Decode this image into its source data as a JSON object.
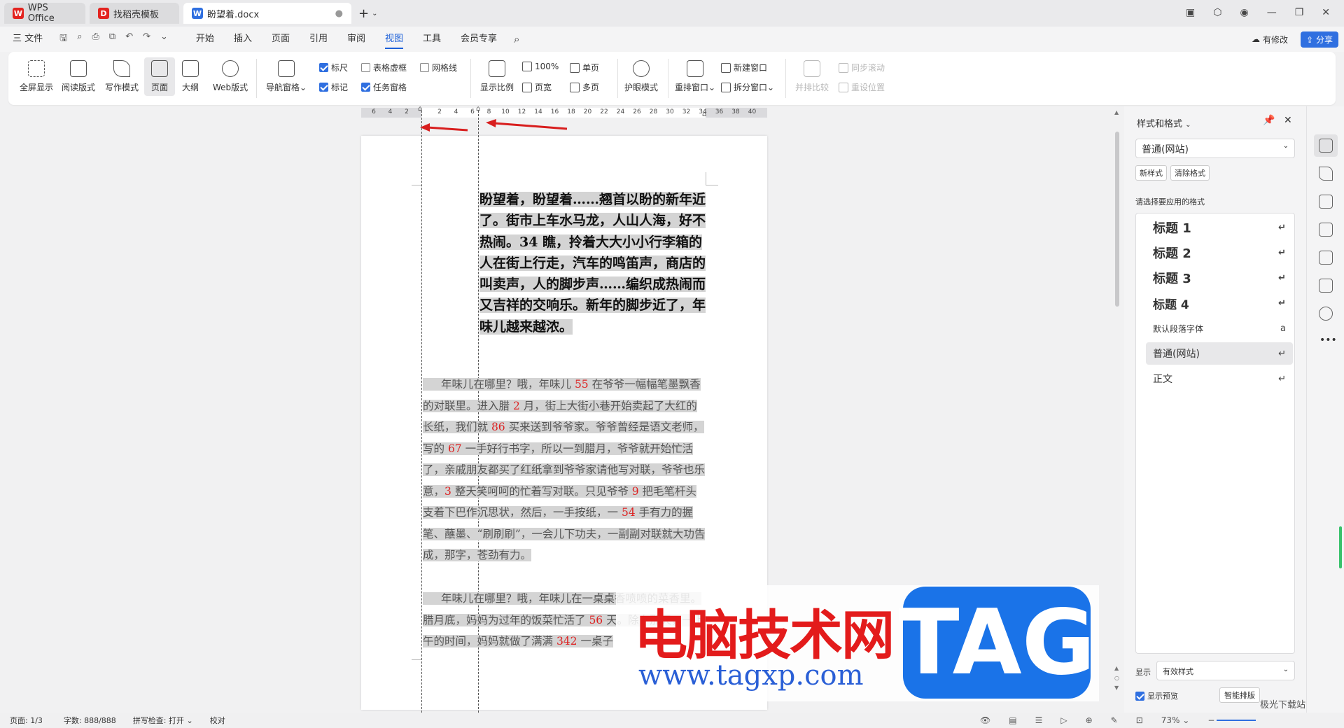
{
  "tabs": [
    {
      "label": "WPS Office",
      "logo": "W",
      "color": "#e3231f"
    },
    {
      "label": "找稻壳模板",
      "logo": "D",
      "color": "#e3231f"
    },
    {
      "label": "盼望着.docx",
      "logo": "W",
      "color": "#2f6fe0"
    }
  ],
  "menu": {
    "file": "三 文件",
    "items": [
      "开始",
      "插入",
      "页面",
      "引用",
      "审阅",
      "视图",
      "工具",
      "会员专享"
    ],
    "active": "视图",
    "modified": "有修改",
    "share": "分享"
  },
  "ribbon": {
    "fullscreen": "全屏显示",
    "reading": "阅读版式",
    "writing": "写作模式",
    "page": "页面",
    "outline": "大纲",
    "web": "Web版式",
    "nav_pane": "导航窗格",
    "ruler": "标尺",
    "marks": "标记",
    "table_grid": "表格虚框",
    "task_pane": "任务窗格",
    "gridlines": "网格线",
    "zoom": "显示比例",
    "hundred": "100%",
    "page_width": "页宽",
    "single_page": "单页",
    "multi_page": "多页",
    "eye_mode": "护眼模式",
    "arrange": "重排窗口",
    "new_window": "新建窗口",
    "split_window": "拆分窗口",
    "side_by_side": "并排比较",
    "sync_scroll": "同步滚动",
    "reset_pos": "重设位置"
  },
  "ruler_ticks": [
    "6",
    "4",
    "2",
    "",
    "2",
    "4",
    "6",
    "8",
    "10",
    "12",
    "14",
    "16",
    "18",
    "20",
    "22",
    "24",
    "26",
    "28",
    "30",
    "32",
    "34",
    "36",
    "38",
    "40"
  ],
  "document": {
    "para1": "盼望着，盼望着……翘首以盼的新年近了。街市上车水马龙，人山人海，好不热闹。34 瞧，拎着大大小小行李箱的人在街上行走，汽车的鸣笛声，商店的叫卖声，人的脚步声……编织成热闹而又吉祥的交响乐。新年的脚步近了，年味儿越来越浓。",
    "para2_parts": [
      "年味儿在哪里？哦，年味儿 ",
      "55",
      " 在爷爷一幅幅笔墨飘香的对联里。进入腊 ",
      "2",
      " 月，街上大街小巷开始卖起了大红的长纸，我们就 ",
      "86",
      " 买来送到爷爷家。爷爷曾经是语文老师，写的 ",
      "67",
      " 一手好行书字，所以一到腊月，爷爷就开始忙活了，亲戚朋友都买了红纸拿到爷爷家请他写对联，爷爷也乐意，",
      "3",
      " 整天笑呵呵的忙着写对联。只见爷爷 ",
      "9",
      " 把毛笔杆头支着下巴作沉思状，然后，一手按纸，一 ",
      "54",
      " 手有力的握笔、蘸墨、“刷刷刷”，一会儿下功夫，一副副对联就大功告成，那字，苍劲有力。"
    ],
    "para3_parts": [
      "年味儿在哪里？哦，年味儿在一桌桌香喷喷的菜香里。腊月底，妈妈为过年的饭菜忙活了 ",
      "56",
      " 天。除夕那天，一上午的时间，妈妈就做了满满 ",
      "342",
      " 一桌子"
    ]
  },
  "panel": {
    "title": "样式和格式",
    "current_style": "普通(网站)",
    "new_style": "新样式",
    "clear_format": "清除格式",
    "apply_label": "请选择要应用的格式",
    "styles": [
      {
        "label": "标题  1",
        "mark": "↵"
      },
      {
        "label": "标题  2",
        "mark": "↵"
      },
      {
        "label": "标题  3",
        "mark": "↵"
      },
      {
        "label": "标题  4",
        "mark": "↵"
      },
      {
        "label": "默认段落字体",
        "mark": "a"
      },
      {
        "label": "普通(网站)",
        "mark": "↵"
      },
      {
        "label": "正文",
        "mark": "↵"
      }
    ],
    "show_label": "显示",
    "show_value": "有效样式",
    "preview": "显示预览",
    "smart": "智能排版"
  },
  "status": {
    "page": "页面: 1/3",
    "words": "字数: 888/888",
    "spell": "拼写检查: 打开",
    "proof": "校对",
    "zoom": "73%"
  },
  "watermark": {
    "cn": "电脑技术网",
    "url": "www.tagxp.com",
    "tag": "TAG",
    "corner": "极光下载站"
  }
}
